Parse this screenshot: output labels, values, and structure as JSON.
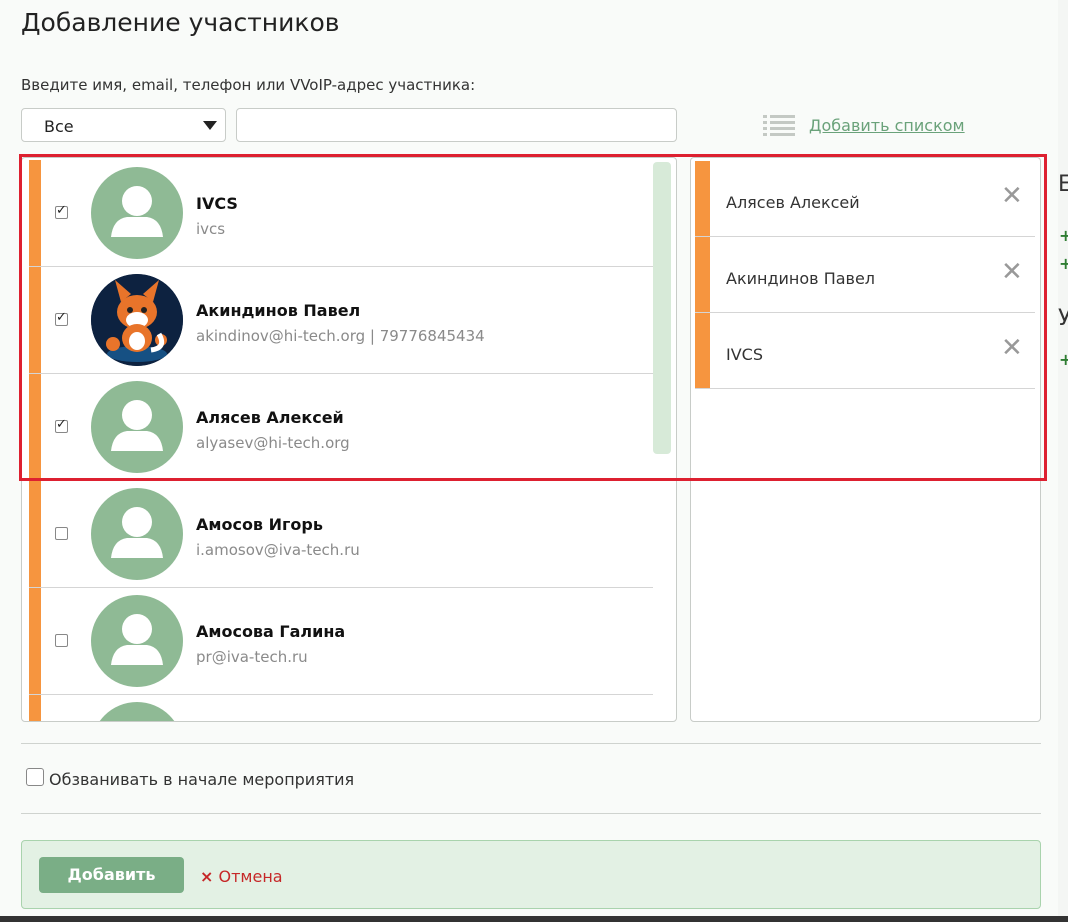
{
  "dialog": {
    "title": "Добавление участников",
    "hint": "Введите имя, email, телефон или VVoIP-адрес участника:",
    "filter_value": "Все",
    "search_value": "",
    "add_list_label": "Добавить списком"
  },
  "contacts": [
    {
      "name": "IVCS",
      "sub": "ivcs",
      "checked": true
    },
    {
      "name": "Акиндинов Павел",
      "sub": "akindinov@hi-tech.org | 79776845434",
      "checked": true
    },
    {
      "name": "Алясев Алексей",
      "sub": "alyasev@hi-tech.org",
      "checked": true
    },
    {
      "name": "Амосов Игорь",
      "sub": "i.amosov@iva-tech.ru",
      "checked": false
    },
    {
      "name": "Амосова Галина",
      "sub": "pr@iva-tech.ru",
      "checked": false
    }
  ],
  "selected": [
    {
      "name": "Алясев Алексей"
    },
    {
      "name": "Акиндинов Павел"
    },
    {
      "name": "IVCS"
    }
  ],
  "options": {
    "call_at_start_label": "Обзванивать в начале мероприятия",
    "call_at_start_checked": false
  },
  "footer": {
    "add_label": "Добавить",
    "cancel_icon": "×",
    "cancel_label": "Отмена"
  },
  "background": {
    "letters": [
      "Е",
      "У"
    ],
    "plus": "+"
  },
  "colors": {
    "accent_orange": "#f6953f",
    "avatar_green": "#8fba95",
    "link_green": "#6aa27a",
    "highlight_red": "#dd2030",
    "cancel_red": "#c62828"
  }
}
